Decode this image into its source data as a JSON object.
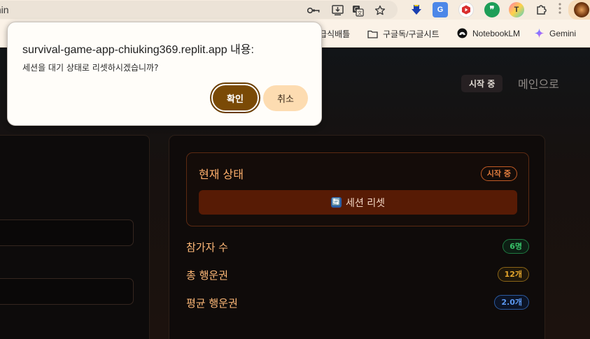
{
  "browser": {
    "address_text": "min",
    "extensions": [
      {
        "name": "download-arrow-icon",
        "color": "#1a3fb0"
      },
      {
        "name": "google-translate-icon",
        "color": "#4c87e8"
      },
      {
        "name": "red-extension-icon",
        "color": "#d92f2f"
      },
      {
        "name": "quote-extension-icon",
        "color": "#1e9e57"
      },
      {
        "name": "t-extension-icon",
        "color": "#e2679b",
        "label": "T"
      }
    ],
    "bookmarks": {
      "item1_label": "급식배틀",
      "item2_label": "구글독/구글시트",
      "item3_label": "NotebookLM",
      "item4_label": "Gemini"
    }
  },
  "dialog": {
    "title": "survival-game-app-chiuking369.replit.app 내용:",
    "message": "세션을 대기 상태로 리셋하시겠습니까?",
    "ok_label": "확인",
    "cancel_label": "취소"
  },
  "header": {
    "status_badge": "시작 중",
    "main_link": "메인으로"
  },
  "status_panel": {
    "title": "현재 상태",
    "badge": "시작 중",
    "reset_button": "세션 리셋"
  },
  "stats": [
    {
      "label": "참가자 수",
      "value": "6명",
      "color": "#38c46a"
    },
    {
      "label": "총 행운권",
      "value": "12개",
      "color": "#e2a42c"
    },
    {
      "label": "평균 행운권",
      "value": "2.0개",
      "color": "#3d7fe0"
    }
  ],
  "colors": {
    "accent_orange": "#ffb06c",
    "reset_button_bg": "#571b05",
    "dialog_ok_bg": "#7a4a06",
    "dialog_cancel_bg": "#fddcb1"
  }
}
